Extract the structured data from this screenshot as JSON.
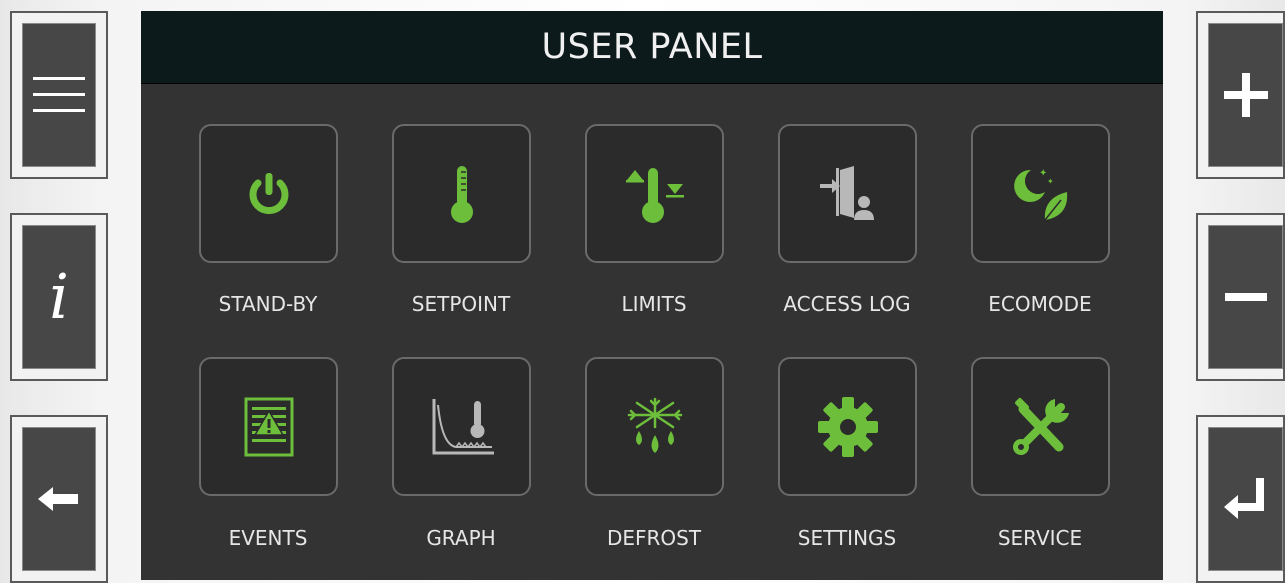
{
  "app": {
    "title": "USER PANEL"
  },
  "left_buttons": [
    {
      "name": "menu",
      "icon": "hamburger-menu-icon"
    },
    {
      "name": "info",
      "icon": "info-icon",
      "glyph": "i"
    },
    {
      "name": "back",
      "icon": "arrow-left-icon"
    }
  ],
  "right_buttons": [
    {
      "name": "plus",
      "icon": "plus-icon"
    },
    {
      "name": "minus",
      "icon": "minus-icon"
    },
    {
      "name": "enter",
      "icon": "enter-return-icon"
    }
  ],
  "menu_items": [
    {
      "label": "STAND-BY",
      "icon": "power-icon"
    },
    {
      "label": "SETPOINT",
      "icon": "thermometer-icon"
    },
    {
      "label": "LIMITS",
      "icon": "thermometer-limits-icon"
    },
    {
      "label": "ACCESS LOG",
      "icon": "door-user-icon"
    },
    {
      "label": "ECOMODE",
      "icon": "moon-leaf-icon"
    },
    {
      "label": "EVENTS",
      "icon": "event-list-alert-icon"
    },
    {
      "label": "GRAPH",
      "icon": "temperature-graph-icon"
    },
    {
      "label": "DEFROST",
      "icon": "snowflake-drops-icon"
    },
    {
      "label": "SETTINGS",
      "icon": "gear-icon"
    },
    {
      "label": "SERVICE",
      "icon": "wrench-screwdriver-icon"
    }
  ],
  "colors": {
    "accent": "#6dbf3b",
    "panel_bg": "#333333",
    "header_bg": "#0d1a1c",
    "icon_gray": "#b8b8b8"
  }
}
